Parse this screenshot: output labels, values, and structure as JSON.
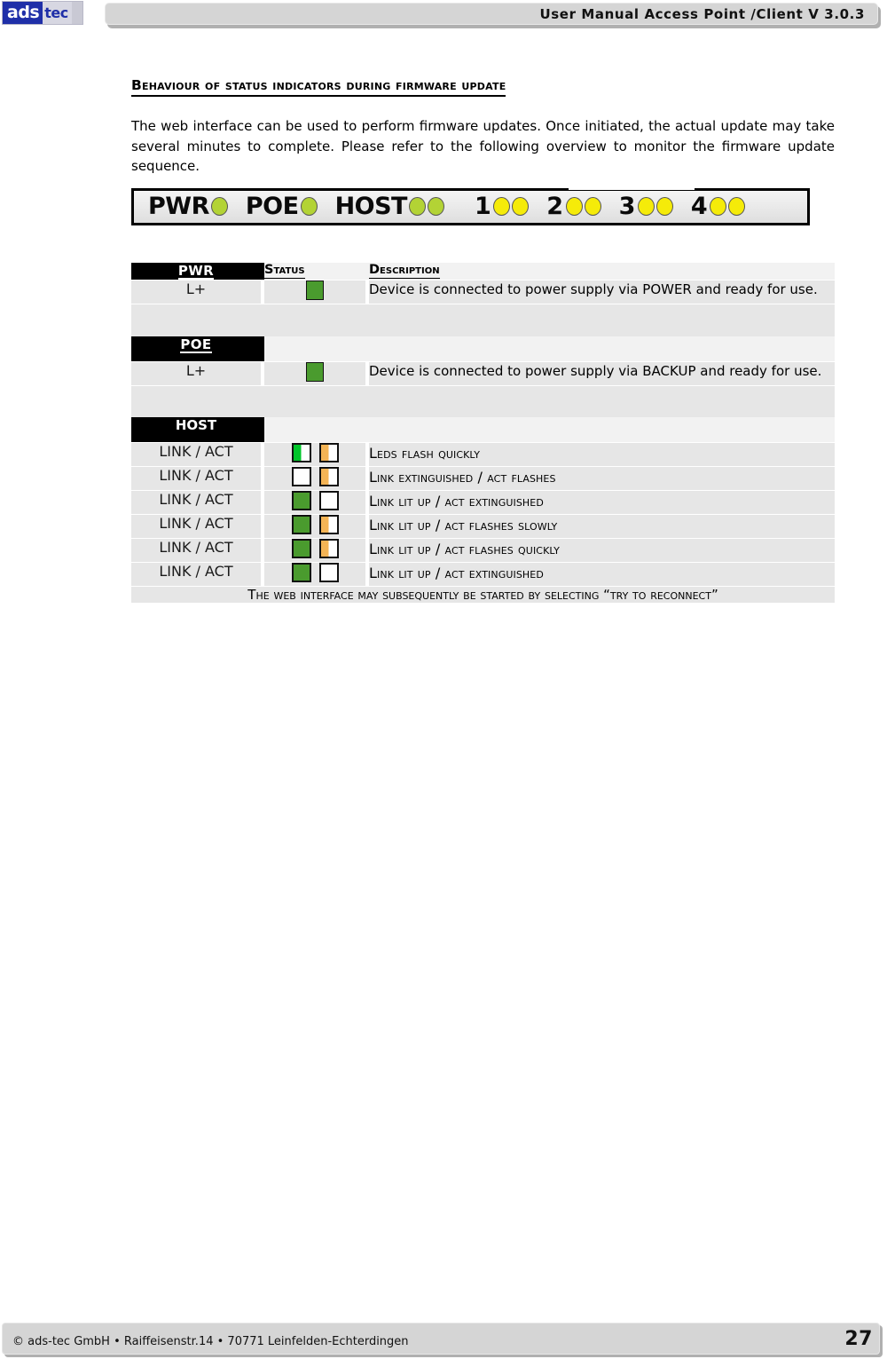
{
  "header": {
    "logo_primary": "ads",
    "logo_secondary": "tec",
    "title": "User Manual Access  Point /Client V 3.0.3"
  },
  "section": {
    "heading": "Behaviour of Status Indicators during Firmware Update",
    "paragraph": "The web interface can be used to perform firmware updates. Once initiated, the actual update may take several minutes to complete. Please refer to the following overview to monitor the firmware update sequence."
  },
  "led_panel": {
    "groups": [
      {
        "label": "PWR",
        "leds": [
          "green"
        ]
      },
      {
        "label": "POE",
        "leds": [
          "green"
        ]
      },
      {
        "label": "HOST",
        "leds": [
          "green",
          "green"
        ]
      }
    ],
    "ports": [
      {
        "label": "1",
        "leds": [
          "yellow",
          "yellow"
        ]
      },
      {
        "label": "2",
        "leds": [
          "yellow",
          "yellow"
        ]
      },
      {
        "label": "3",
        "leds": [
          "yellow",
          "yellow"
        ]
      },
      {
        "label": "4",
        "leds": [
          "yellow",
          "yellow"
        ]
      }
    ],
    "colors": {
      "green": "#b3d335",
      "yellow": "#f5eb09"
    }
  },
  "table": {
    "columns": {
      "name": "PWR",
      "status": "Status",
      "description": "Description"
    },
    "sections": [
      {
        "header": "PWR",
        "status_header": "Status",
        "description_header": "Description",
        "rows": [
          {
            "name": "L+",
            "swatches": [
              "solid-green"
            ],
            "description": "Device is connected to power supply via POWER and ready for use."
          }
        ]
      },
      {
        "header": "POE",
        "status_header": "",
        "description_header": "",
        "rows": [
          {
            "name": "L+",
            "swatches": [
              "solid-green"
            ],
            "description": "Device is connected to power supply via BACKUP and ready for use."
          }
        ]
      },
      {
        "header": "HOST",
        "status_header": "",
        "description_header": "",
        "rows": [
          {
            "name": "LINK / ACT",
            "swatches": [
              "half-green",
              "half-orange"
            ],
            "description": "LEDs flash quickly"
          },
          {
            "name": "LINK / ACT",
            "swatches": [
              "solid-white",
              "half-orange"
            ],
            "description": "LINK extinguished / Act  flashes"
          },
          {
            "name": "LINK / ACT",
            "swatches": [
              "solid-green",
              "solid-white"
            ],
            "description": "LINK lit up / ACT extinguished"
          },
          {
            "name": "LINK / ACT",
            "swatches": [
              "solid-green",
              "half-orange"
            ],
            "description": "LINK lit up / ACT flashes slowly"
          },
          {
            "name": "LINK / ACT",
            "swatches": [
              "solid-green",
              "half-orange"
            ],
            "description": "LINK lit up / ACT flashes quickly"
          },
          {
            "name": "LINK / ACT",
            "swatches": [
              "solid-green",
              "solid-white"
            ],
            "description": "LINK lit up / ACT extinguished"
          }
        ]
      }
    ],
    "note": "The web interface may subsequently be started by selecting “Try to Reconnect”"
  },
  "footer": {
    "text": "© ads-tec GmbH • Raiffeisenstr.14 • 70771 Leinfelden-Echterdingen",
    "page_number": "27"
  }
}
